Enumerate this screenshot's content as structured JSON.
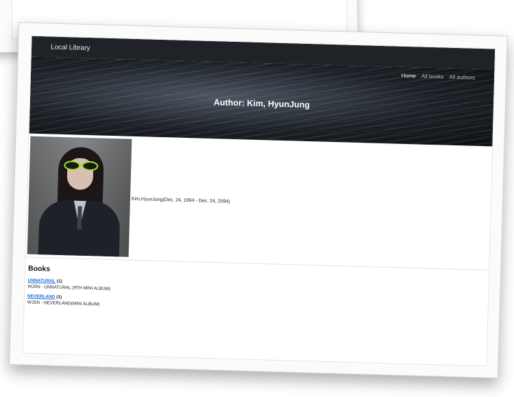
{
  "site": {
    "brand": "Local Library"
  },
  "nav": {
    "home": "Home",
    "all_books": "All books",
    "all_authors": "All authors"
  },
  "hero": {
    "title": "Author: Kim, HyunJung"
  },
  "author": {
    "details": "Kim,HyunJung(Dec. 24, 1994 - Dec. 24, 2094)"
  },
  "books": {
    "heading": "Books",
    "items": [
      {
        "title": "UNNATURAL",
        "count": "(1)",
        "summary": "WJSN - UNNATURAL (9TH MINI ALBUM)"
      },
      {
        "title": "NEVERLAND",
        "count": "(1)",
        "summary": "WJSN - NEVERLAND(MINI ALBUM)"
      }
    ]
  },
  "colors": {
    "navbar": "#1f2226",
    "link": "#1a6fe0"
  }
}
